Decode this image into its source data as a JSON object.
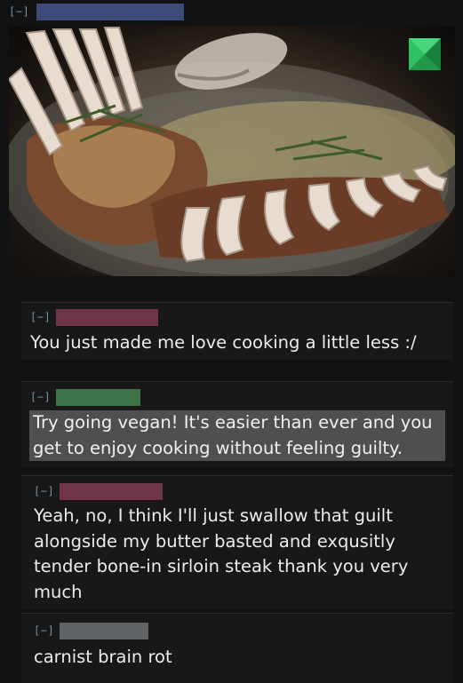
{
  "collapse_label": "[−]",
  "post": {
    "image_icon": "green-pinwheel-icon"
  },
  "comments": [
    {
      "text": "You just made me love cooking a little less :/",
      "highlight": false
    },
    {
      "text": "Try going vegan! It's easier than ever and you get to enjoy cooking without feeling guilty.",
      "highlight": true
    },
    {
      "text": "Yeah, no, I think I'll just swallow that guilt alongside my butter basted and exqusitly tender bone-in sirloin steak thank you very much",
      "highlight": false
    },
    {
      "text": "carnist brain rot",
      "highlight": false
    }
  ],
  "colors": {
    "background": "#121212",
    "comment_bg": "#181818",
    "collapse": "#6d93a8",
    "redact_blue": "#3c4b78",
    "redact_maroon": "#6e3447",
    "redact_green": "#3b7248",
    "redact_gray": "#5f6365",
    "highlight_bg": "#4f4f4f"
  }
}
